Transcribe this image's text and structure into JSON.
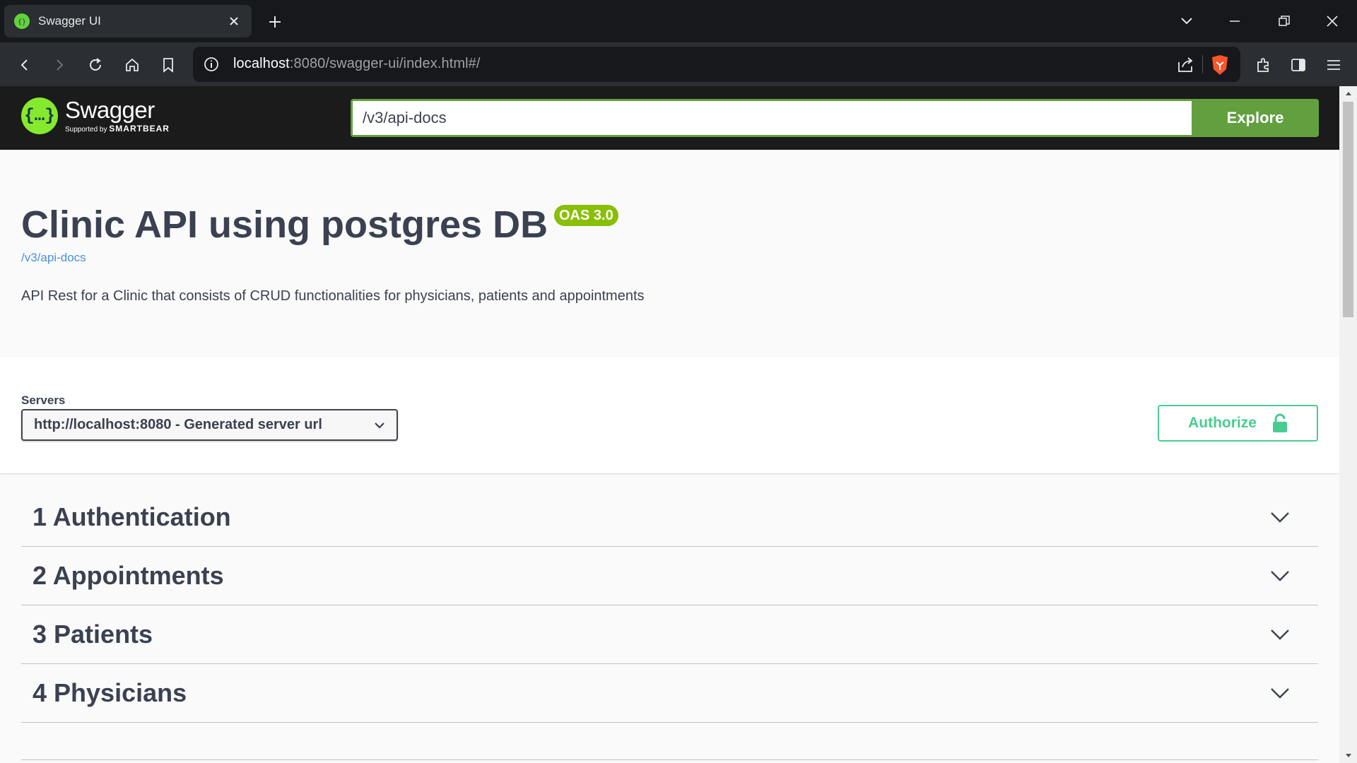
{
  "browser": {
    "tab_title": "Swagger UI",
    "url_host": "localhost",
    "url_rest": ":8080/swagger-ui/index.html#/"
  },
  "topbar": {
    "logo_name": "Swagger",
    "logo_supported_prefix": "Supported by",
    "logo_supported_brand": "SMARTBEAR",
    "url_value": "/v3/api-docs",
    "explore_label": "Explore"
  },
  "info": {
    "title": "Clinic API using postgres DB",
    "version_badge": "OAS 3.0",
    "spec_link": "/v3/api-docs",
    "description": "API Rest for a Clinic that consists of CRUD functionalities for physicians, patients and appointments"
  },
  "servers": {
    "label": "Servers",
    "selected": "http://localhost:8080 - Generated server url"
  },
  "authorize": {
    "label": "Authorize"
  },
  "tags": [
    {
      "name": "1 Authentication"
    },
    {
      "name": "2 Appointments"
    },
    {
      "name": "3 Patients"
    },
    {
      "name": "4 Physicians"
    }
  ],
  "colors": {
    "swagger_green": "#62a03f",
    "authorize_green": "#49cc90",
    "badge_green": "#89bf04",
    "text_dark": "#3b4151",
    "link_blue": "#4990e2"
  }
}
